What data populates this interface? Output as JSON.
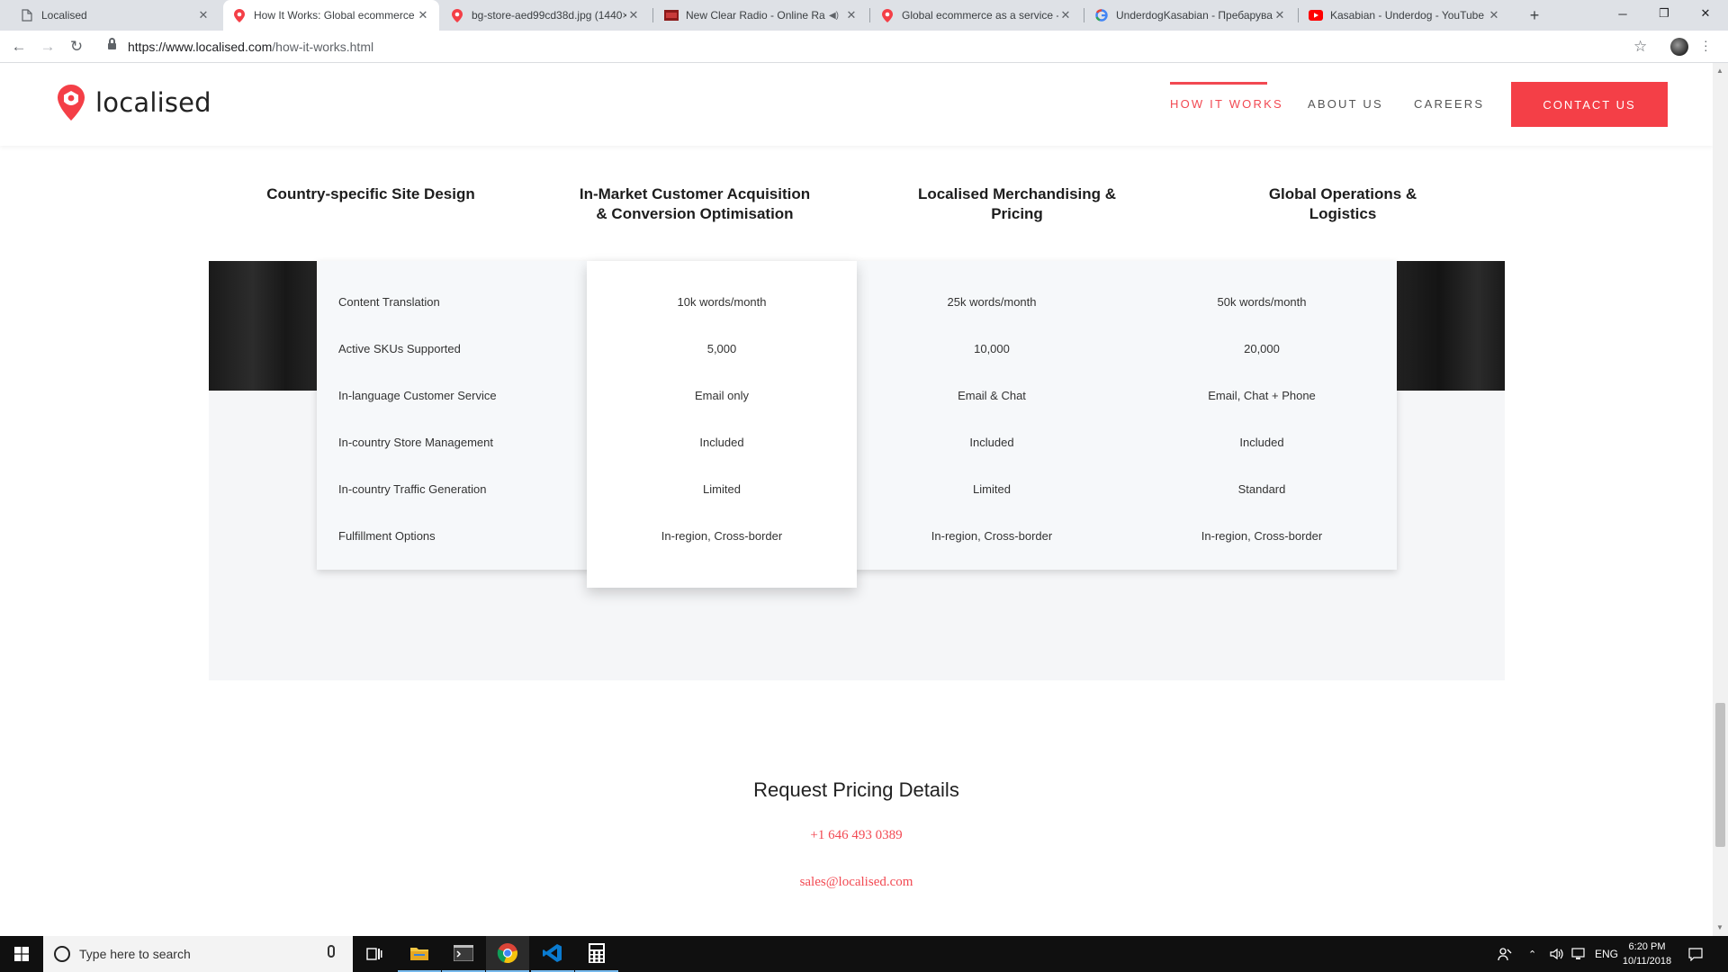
{
  "browser": {
    "tabs": [
      {
        "title": "Localised",
        "icon": "page-icon",
        "active": false
      },
      {
        "title": "How It Works: Global ecommerce",
        "icon": "localised-pin-icon",
        "active": true
      },
      {
        "title": "bg-store-aed99cd38d.jpg (1440×",
        "icon": "localised-pin-icon",
        "active": false
      },
      {
        "title": "New Clear Radio - Online Ra",
        "icon": "radio-favicon-icon",
        "active": false,
        "audio": true
      },
      {
        "title": "Global ecommerce as a service -",
        "icon": "localised-pin-icon",
        "active": false
      },
      {
        "title": "UnderdogKasabian - Пребаруван",
        "icon": "google-icon",
        "active": false
      },
      {
        "title": "Kasabian - Underdog - YouTube",
        "icon": "youtube-icon",
        "active": false
      }
    ],
    "url_host": "https://www.localised.com",
    "url_path": "/how-it-works.html"
  },
  "site": {
    "logo_text": "localised",
    "nav": [
      "HOW IT WORKS",
      "ABOUT US",
      "CAREERS"
    ],
    "contact_label": "CONTACT US",
    "brand_color": "#f43f47"
  },
  "columns": [
    "Country-specific Site Design",
    "In-Market Customer Acquisition & Conversion Optimisation",
    "Localised Merchandising & Pricing",
    "Global Operations & Logistics"
  ],
  "plans": {
    "rows": [
      {
        "label": "Content Translation",
        "values": [
          "10k words/month",
          "25k words/month",
          "50k words/month"
        ]
      },
      {
        "label": "Active SKUs Supported",
        "values": [
          "5,000",
          "10,000",
          "20,000"
        ]
      },
      {
        "label": "In-language Customer Service",
        "values": [
          "Email only",
          "Email & Chat",
          "Email, Chat + Phone"
        ]
      },
      {
        "label": "In-country Store Management",
        "values": [
          "Included",
          "Included",
          "Included"
        ]
      },
      {
        "label": "In-country Traffic Generation",
        "values": [
          "Limited",
          "Limited",
          "Standard"
        ]
      },
      {
        "label": "Fulfillment Options",
        "values": [
          "In-region, Cross-border",
          "In-region, Cross-border",
          "In-region, Cross-border"
        ]
      }
    ]
  },
  "request": {
    "title": "Request Pricing Details",
    "phone": "+1 646 493 0389",
    "email": "sales@localised.com"
  },
  "taskbar": {
    "search_placeholder": "Type here to search",
    "language": "ENG",
    "time": "6:20 PM",
    "date": "10/11/2018"
  }
}
